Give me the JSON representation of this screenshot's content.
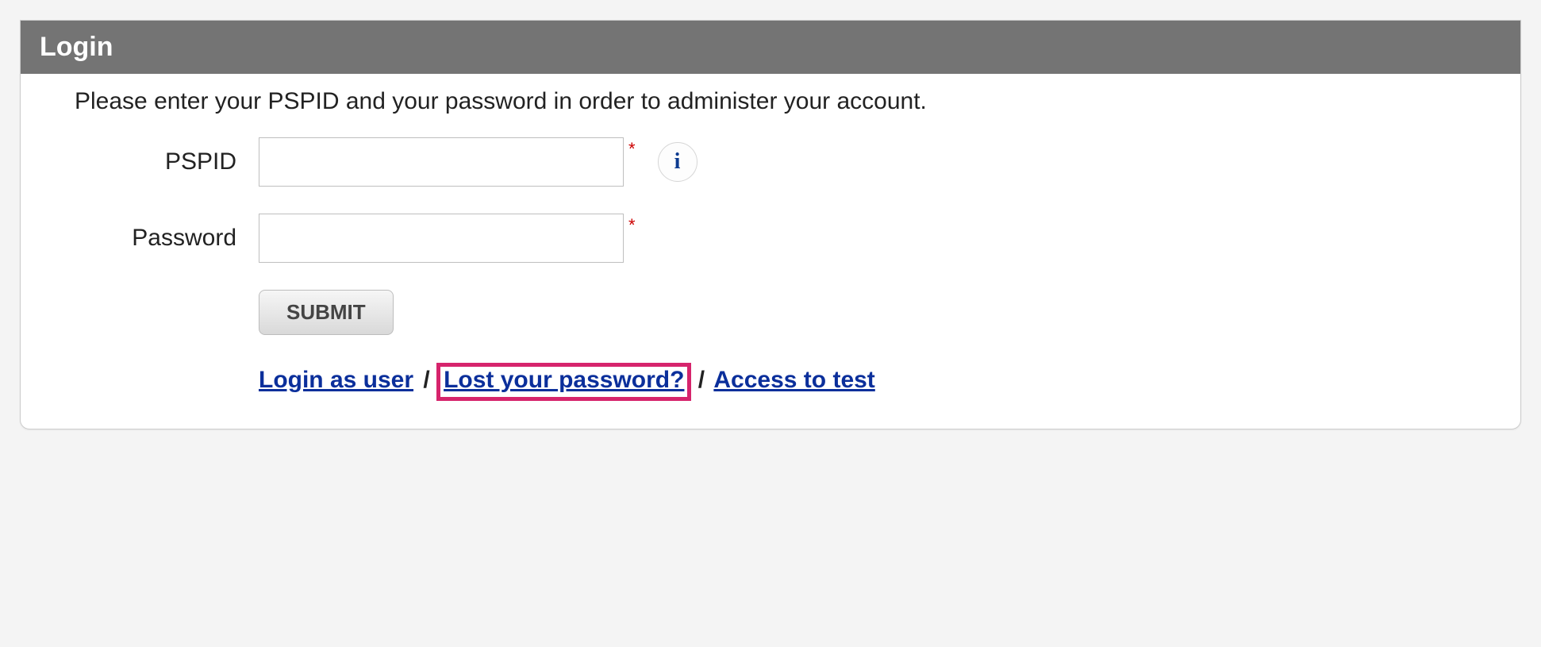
{
  "header": {
    "title": "Login"
  },
  "intro": "Please enter your PSPID and your password in order to administer your account.",
  "fields": {
    "pspid": {
      "label": "PSPID",
      "required": "*"
    },
    "password": {
      "label": "Password",
      "required": "*"
    }
  },
  "info_icon_glyph": "i",
  "submit_label": "SUBMIT",
  "links": {
    "login_as_user": "Login as user",
    "lost_password": "Lost your password?",
    "access_to_test": "Access to test",
    "separator": "/"
  }
}
